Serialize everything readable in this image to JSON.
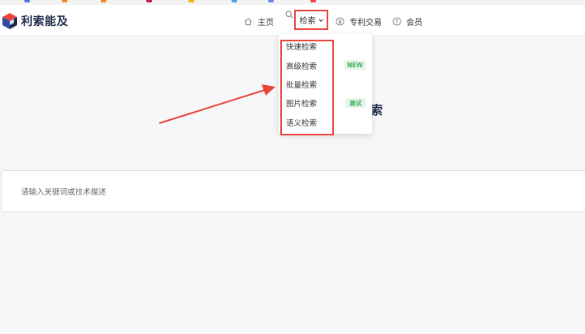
{
  "brand": {
    "name": "利索能及"
  },
  "nav": {
    "home": "主页",
    "search": "检索",
    "trade": "专利交易",
    "member": "会员"
  },
  "search_menu": {
    "items": [
      {
        "label": "快速检索",
        "badge": ""
      },
      {
        "label": "高级检索",
        "badge": "NEW"
      },
      {
        "label": "批量检索",
        "badge": ""
      },
      {
        "label": "图片检索",
        "badge": "测试"
      },
      {
        "label": "语义检索",
        "badge": ""
      }
    ]
  },
  "main": {
    "title_fragment": "索",
    "search_placeholder": "请输入关键词或技术描述"
  },
  "colors": {
    "annotation_red": "#e8453c",
    "badge_green": "#3fae5b",
    "badge_bg": "#e6f6ea",
    "brand_navy": "#1e2a4a"
  }
}
